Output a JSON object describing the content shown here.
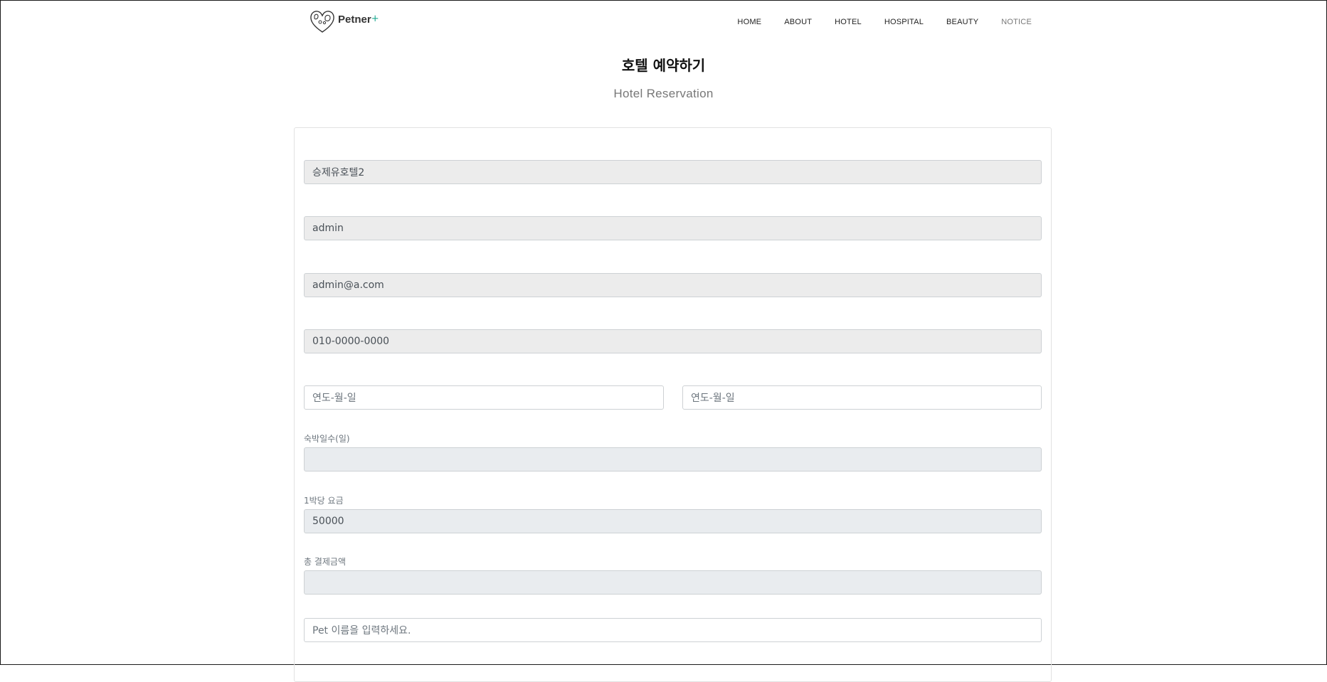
{
  "brand": {
    "name": "Petner",
    "plus": "+"
  },
  "nav": {
    "items": [
      "HOME",
      "ABOUT",
      "HOTEL",
      "HOSPITAL",
      "BEAUTY",
      "NOTICE"
    ]
  },
  "page": {
    "title": "호텔 예약하기",
    "subtitle": "Hotel Reservation"
  },
  "form": {
    "hotel_name": "승제유호텔2",
    "user_id": "admin",
    "email": "admin@a.com",
    "phone": "010-0000-0000",
    "checkin_placeholder": "연도-월-일",
    "checkout_placeholder": "연도-월-일",
    "nights_label": "숙박일수(일)",
    "nights_value": "",
    "price_label": "1박당 요금",
    "price_value": "50000",
    "total_label": "총 결제금액",
    "total_value": "",
    "pet_placeholder": "Pet 이름을 입력하세요."
  },
  "colors": {
    "accent": "#1aa88f",
    "readonly_bg": "#ececec",
    "disabled_bg": "#e9ecef"
  },
  "icons": {
    "logo": "pet-heart-logo-icon"
  }
}
